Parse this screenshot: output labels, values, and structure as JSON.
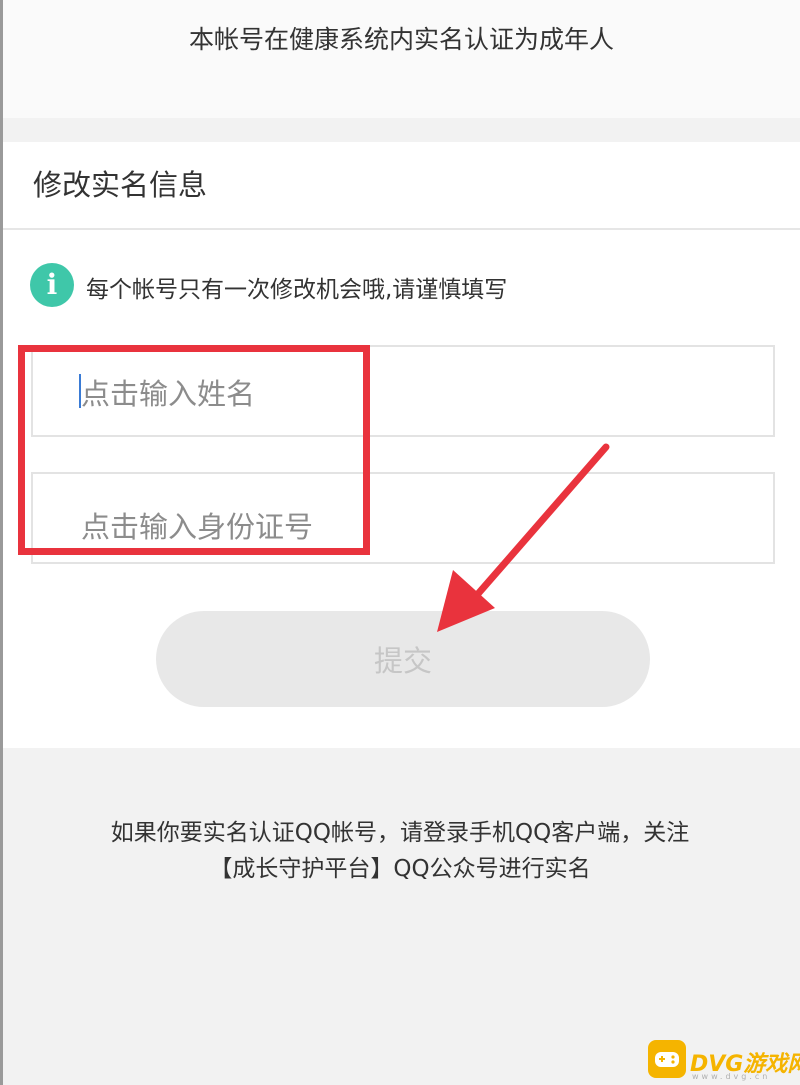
{
  "header": {
    "status_text": "本帐号在健康系统内实名认证为成年人"
  },
  "form": {
    "title": "修改实名信息",
    "notice": "每个帐号只有一次修改机会哦,请谨慎填写",
    "info_icon": "i",
    "name_placeholder": "点击输入姓名",
    "id_placeholder": "点击输入身份证号",
    "submit_label": "提交"
  },
  "footer": {
    "line1": "如果你要实名认证QQ帐号，请登录手机QQ客户端，关注",
    "line2": "【成长守护平台】QQ公众号进行实名"
  },
  "watermark": {
    "text": "DVG游戏网",
    "sub": "www.dvg.cn"
  },
  "colors": {
    "annotation_red": "#e9333d",
    "info_green": "#3fc7a9",
    "watermark_gold": "#f5b400"
  },
  "icons": {
    "info": "info-icon",
    "annotation_arrow": "arrow-icon",
    "watermark_logo": "gamepad-icon"
  }
}
